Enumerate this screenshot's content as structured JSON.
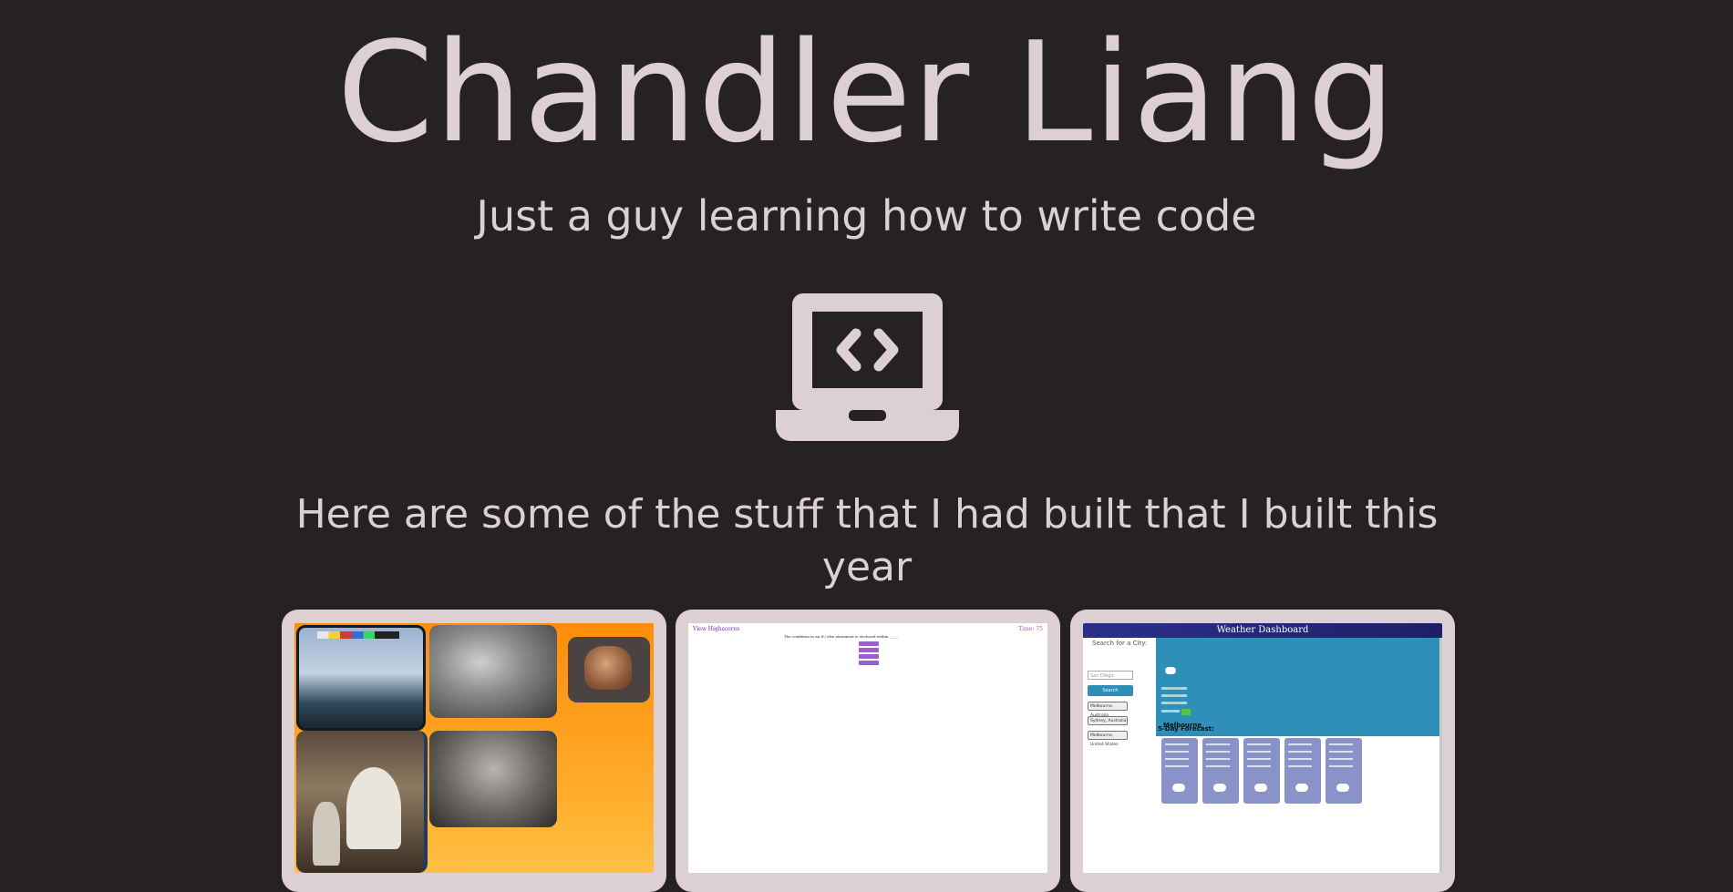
{
  "hero": {
    "name": "Chandler Liang",
    "tagline": "Just a guy learning how to write code"
  },
  "icons": {
    "hero_icon": "laptop-code-icon"
  },
  "colors": {
    "background": "#272222",
    "text": "#dcd0d2",
    "card_frame": "#dcd0d2"
  },
  "projects": {
    "heading": "Here are some of the stuff that I had built that I built this year",
    "items": [
      {
        "kind": "art-gallery"
      },
      {
        "kind": "code-quiz",
        "highscores_label": "View Highscores",
        "time_label": "Time: 75",
        "question": "The condition in an if / else statement is enclosed within ____."
      },
      {
        "kind": "weather-dashboard",
        "title": "Weather Dashboard",
        "search_label": "Search for a City:",
        "search_placeholder": "San Diego",
        "search_button": "Search",
        "history": [
          "Melbourne, Australia",
          "Sydney, Australia",
          "Melbourne, United States"
        ],
        "city": "Melbourne",
        "forecast_label": "5-Day Forecast:"
      }
    ]
  }
}
